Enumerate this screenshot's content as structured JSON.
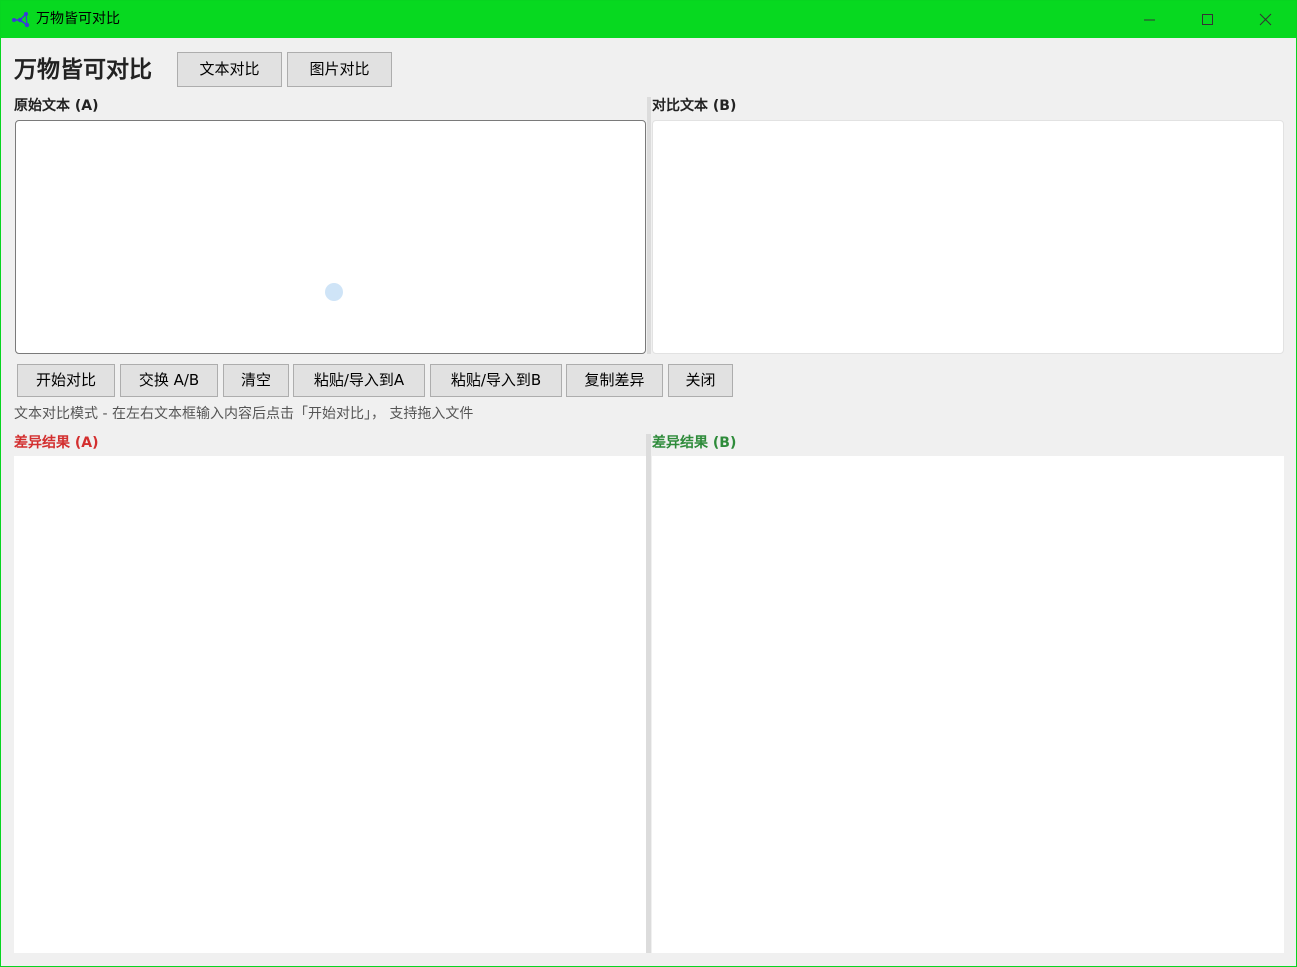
{
  "window": {
    "title": "万物皆可对比",
    "titlebar_color": "#07d920",
    "icons": {
      "app": "network-nodes-icon",
      "minimize": "minimize-icon",
      "maximize": "maximize-icon",
      "close": "close-icon"
    }
  },
  "header": {
    "app_title": "万物皆可对比",
    "mode_buttons": [
      "文本对比",
      "图片对比"
    ]
  },
  "inputs": {
    "a_label": "原始文本 (A)",
    "b_label": "对比文本 (B)",
    "a_value": "",
    "b_value": ""
  },
  "toolbar": {
    "compare": "开始对比",
    "swap": "交换 A/B",
    "clear": "清空",
    "paste_a": "粘贴/导入到A",
    "paste_b": "粘贴/导入到B",
    "copy_diff": "复制差异",
    "close": "关闭"
  },
  "status": {
    "hint": "文本对比模式 - 在左右文本框输入内容后点击「开始对比」， 支持拖入文件"
  },
  "results": {
    "a_label": "差异结果 (A)",
    "b_label": "差异结果 (B)",
    "a_color": "#d32f2f",
    "b_color": "#2e8b3a"
  }
}
